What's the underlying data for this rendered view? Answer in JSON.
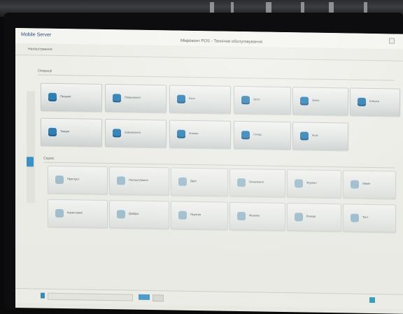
{
  "window": {
    "app_name": "Mobile Server",
    "title": "Мікроконт POS - Технічне обслуговування"
  },
  "menu": {
    "first_item": "Налаштування"
  },
  "sections": [
    {
      "label": "Операції",
      "tiles": [
        {
          "label": "Продажі",
          "icon": "cart-icon"
        },
        {
          "label": "Повернення",
          "icon": "return-icon"
        },
        {
          "label": "Каса",
          "icon": "register-icon"
        },
        {
          "label": "Звіти",
          "icon": "report-icon"
        },
        {
          "label": "Зміна",
          "icon": "shift-icon"
        },
        {
          "label": "Клієнти",
          "icon": "customer-icon"
        },
        {
          "label": "Товари",
          "icon": "goods-icon"
        },
        {
          "label": "Замовлення",
          "icon": "order-icon"
        },
        {
          "label": "Знижки",
          "icon": "discount-icon"
        },
        {
          "label": "Склад",
          "icon": "warehouse-icon"
        },
        {
          "label": "Інше",
          "icon": "more-icon"
        }
      ]
    },
    {
      "label": "Сервіс",
      "tiles": [
        {
          "label": "Пристрої",
          "icon": "device-icon"
        },
        {
          "label": "Налаштування",
          "icon": "settings-icon"
        },
        {
          "label": "Друк",
          "icon": "print-icon"
        },
        {
          "label": "Оновлення",
          "icon": "update-icon"
        },
        {
          "label": "Журнал",
          "icon": "log-icon"
        },
        {
          "label": "Обмін",
          "icon": "sync-icon"
        },
        {
          "label": "Користувачі",
          "icon": "users-icon"
        },
        {
          "label": "Довідка",
          "icon": "help-icon"
        },
        {
          "label": "Ліцензія",
          "icon": "license-icon"
        },
        {
          "label": "Мережа",
          "icon": "network-icon"
        },
        {
          "label": "Резерв",
          "icon": "backup-icon"
        },
        {
          "label": "Тест",
          "icon": "test-icon"
        }
      ]
    }
  ],
  "statusbar": {
    "input_placeholder": "",
    "right_label": ""
  },
  "colors": {
    "accent": "#2f7fb4",
    "tile_bg": "#e2e5e3",
    "screen_bg": "#efefea"
  }
}
